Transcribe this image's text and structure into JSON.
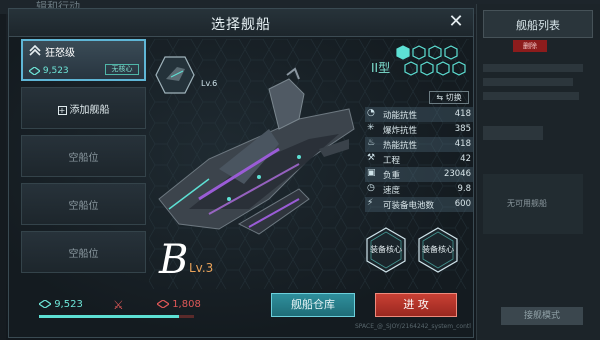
{
  "background": {
    "top_tab_text": "辑和行动",
    "right_panel": {
      "title": "舰船列表",
      "delete_label": "删除",
      "noship_label": "无可用舰船",
      "bottom_button": "接舰模式"
    }
  },
  "dialog": {
    "title": "选择舰船",
    "close_icon": "close-icon"
  },
  "slots": [
    {
      "type": "ship",
      "name": "狂怒级",
      "power": "9,523",
      "core_tag": "无核心"
    },
    {
      "type": "add",
      "label": "添加舰船"
    },
    {
      "type": "empty",
      "label": "空船位"
    },
    {
      "type": "empty",
      "label": "空船位"
    },
    {
      "type": "empty",
      "label": "空船位"
    }
  ],
  "ship": {
    "level_badge": "Lv.6",
    "grade": "B",
    "grade_level": "Lv.3",
    "type_label": "II型",
    "switch_label": "切换"
  },
  "stats": [
    {
      "icon": "shield-icon",
      "label": "动能抗性",
      "value": "418"
    },
    {
      "icon": "blast-icon",
      "label": "爆炸抗性",
      "value": "385"
    },
    {
      "icon": "flame-icon",
      "label": "热能抗性",
      "value": "418"
    },
    {
      "icon": "wrench-icon",
      "label": "工程",
      "value": "42"
    },
    {
      "icon": "weight-icon",
      "label": "负重",
      "value": "23046"
    },
    {
      "icon": "speed-icon",
      "label": "速度",
      "value": "9.8"
    },
    {
      "icon": "battery-icon",
      "label": "可装备电池数",
      "value": "600"
    }
  ],
  "equip": [
    {
      "label": "装备核心"
    },
    {
      "label": "装备核心"
    }
  ],
  "bottom": {
    "player_power": "9,523",
    "enemy_power": "1,808",
    "power_ratio": 0.9,
    "hangar_label": "舰船仓库",
    "attack_label": "进 攻",
    "footer_note": "SPACE_@_SJOY/2164242_system_contl"
  },
  "colors": {
    "accent": "#5de0d4",
    "danger": "#e05858",
    "attack": "#c94034",
    "hangar": "#2f8f9c"
  }
}
